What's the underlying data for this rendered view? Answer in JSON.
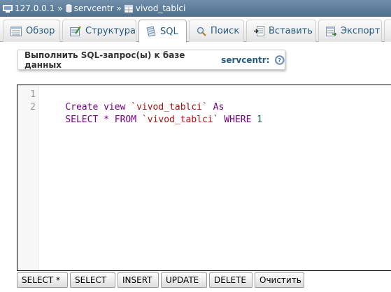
{
  "breadcrumb": {
    "server": "127.0.0.1",
    "separator": "»",
    "database": "servcentr",
    "table": "vivod_tablci"
  },
  "tabs": [
    {
      "label": "Обзор",
      "icon": "browse-icon"
    },
    {
      "label": "Структура",
      "icon": "structure-icon"
    },
    {
      "label": "SQL",
      "icon": "sql-icon",
      "active": true
    },
    {
      "label": "Поиск",
      "icon": "search-icon"
    },
    {
      "label": "Вставить",
      "icon": "insert-icon"
    },
    {
      "label": "Экспорт",
      "icon": "export-icon"
    }
  ],
  "query_box": {
    "label": "Выполнить SQL-запрос(ы) к базе данных",
    "database": "servcentr:"
  },
  "editor": {
    "lines": [
      {
        "number": "1",
        "text": "Create view `vivod_tablci` As"
      },
      {
        "number": "2",
        "text": "SELECT * FROM `vivod_tablci` WHERE 1"
      }
    ]
  },
  "buttons": {
    "select_star": "SELECT *",
    "select": "SELECT",
    "insert": "INSERT",
    "update": "UPDATE",
    "delete": "DELETE",
    "clear": "Очистить"
  },
  "colors": {
    "keyword": "#770088",
    "string": "#aa1111",
    "number": "#116644",
    "link": "#235a81"
  }
}
